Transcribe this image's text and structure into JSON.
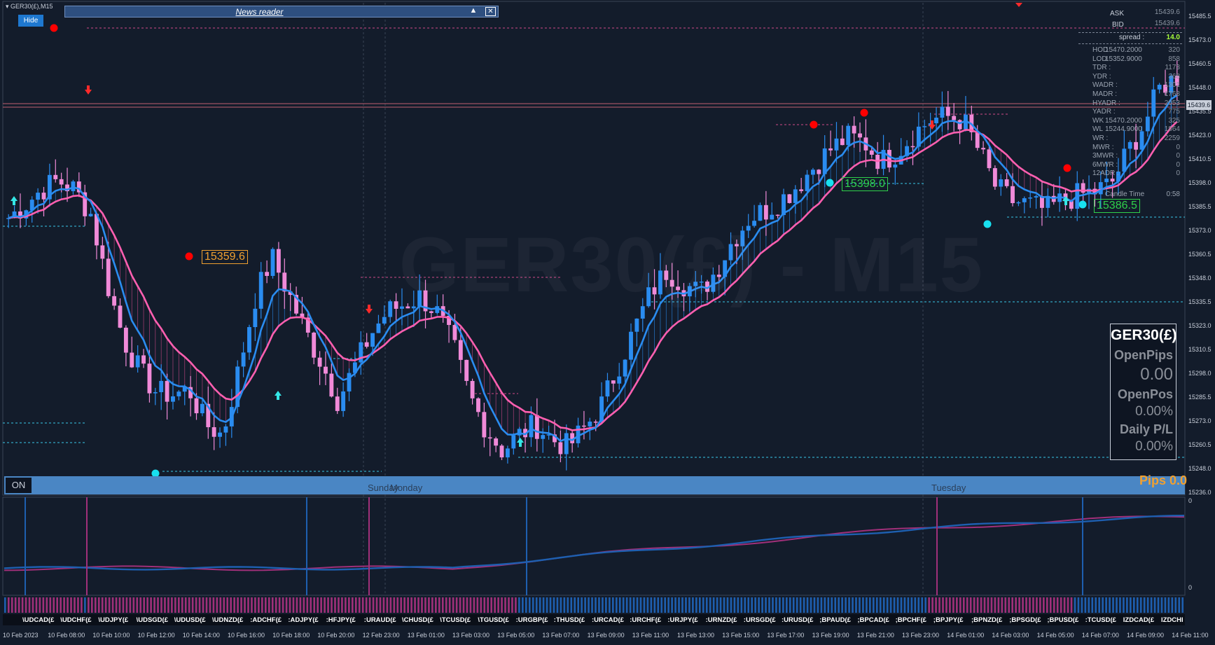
{
  "window": {
    "symbol_title": "GER30(£),M15",
    "watermark": "GER30(£) - M15"
  },
  "news_reader": {
    "title": "News reader",
    "collapse_icon": "triangle-up-icon",
    "close_icon": "close-icon"
  },
  "hide_button": {
    "label": "Hide"
  },
  "info_panel": {
    "ask_label": "ASK",
    "ask_value": "15439.6",
    "bid_label": "BID",
    "bid_value": "15439.6",
    "spread_label": "spread :",
    "spread_value": "14.0",
    "rows": [
      {
        "label": "HOD",
        "mid": "15470.2000",
        "value": "320"
      },
      {
        "label": "LOD",
        "mid": "15352.9000",
        "value": "858"
      },
      {
        "label": "TDR :",
        "value": "1173"
      },
      {
        "label": "YDR :",
        "value": "368"
      },
      {
        "label": "WADR :",
        "value": "1301"
      },
      {
        "label": "MADR :",
        "value": "1768"
      },
      {
        "label": "HYADR :",
        "value": "2053"
      },
      {
        "label": "YADR :",
        "value": "775"
      },
      {
        "label": "WK",
        "mid": "15470.2000",
        "value": "325"
      },
      {
        "label": "WL",
        "mid": "15244.9000",
        "value": "1864"
      },
      {
        "label": "WR :",
        "value": "2259"
      },
      {
        "label": "MWR :",
        "value": "0"
      },
      {
        "label": "3MWR :",
        "value": "0"
      },
      {
        "label": "6MWR :",
        "value": "0"
      },
      {
        "label": "12ADR :",
        "value": "0"
      }
    ],
    "candle_time_label": "Candle Time",
    "candle_time_value": "0:58"
  },
  "price_axis": [
    "15485.5",
    "15473.0",
    "15460.5",
    "15448.0",
    "15435.5",
    "15423.0",
    "15410.5",
    "15398.0",
    "15385.5",
    "15373.0",
    "15360.5",
    "15348.0",
    "15335.5",
    "15323.0",
    "15310.5",
    "15298.0",
    "15285.5",
    "15273.0",
    "15260.5",
    "15248.0",
    "15236.0"
  ],
  "current_price_label": "15439.6",
  "osc_axis": {
    "top": "0",
    "bottom": "0"
  },
  "price_tags": [
    {
      "text": "15359.6",
      "color": "#f0a030"
    },
    {
      "text": "15398.0",
      "color": "#2fd04a"
    },
    {
      "text": "15386.5",
      "color": "#2fd04a"
    }
  ],
  "day_labels": [
    "Sunday",
    "Monday",
    "Tuesday"
  ],
  "pnl_panel": {
    "symbol": "GER30(£)",
    "open_pips_label": "OpenPips",
    "open_pips_value": "0.00",
    "open_pos_label": "OpenPos",
    "open_pos_value": "0.00%",
    "daily_pl_label": "Daily P/L",
    "daily_pl_value": "0.00%"
  },
  "bottom_bar": {
    "on_label": "ON",
    "pips_label": "Pips 0.0"
  },
  "symbol_strip": [
    "\\UDCAD(£",
    "\\UDCHF(£",
    "\\UDJPY(£",
    "\\UDSGD(£",
    "\\UDUSD(£",
    "\\UDNZD(£",
    ":ADCHF(£",
    ":ADJPY(£",
    ":HFJPY(£",
    ":URAUD(£",
    "\\CHUSD(£",
    "\\TCUSD(£",
    "\\TGUSD(£",
    ":URGBP(£",
    ":THUSD(£",
    ":URCAD(£",
    ":URCHF(£",
    ":URJPY(£",
    ":URNZD(£",
    ":URSGD(£",
    ":URUSD(£",
    ";BPAUD(£",
    ";BPCAD(£",
    ";BPCHF(£",
    ";BPJPY(£",
    ";BPNZD(£",
    ";BPSGD(£",
    ";BPUSD(£",
    ":TCUSD(£",
    "IZDCAD(£",
    "IZDCHI"
  ],
  "time_axis": [
    "10 Feb 2023",
    "10 Feb 08:00",
    "10 Feb 10:00",
    "10 Feb 12:00",
    "10 Feb 14:00",
    "10 Feb 16:00",
    "10 Feb 18:00",
    "10 Feb 20:00",
    "12 Feb 23:00",
    "13 Feb 01:00",
    "13 Feb 03:00",
    "13 Feb 05:00",
    "13 Feb 07:00",
    "13 Feb 09:00",
    "13 Feb 11:00",
    "13 Feb 13:00",
    "13 Feb 15:00",
    "13 Feb 17:00",
    "13 Feb 19:00",
    "13 Feb 21:00",
    "13 Feb 23:00",
    "14 Feb 01:00",
    "14 Feb 03:00",
    "14 Feb 05:00",
    "14 Feb 07:00",
    "14 Feb 09:00",
    "14 Feb 11:00"
  ],
  "colors": {
    "bull": "#2a8cf0",
    "bear": "#f08ad8",
    "ma_pink": "#ff5fb0",
    "ma_blue": "#2a8cf0",
    "background": "#131c2b",
    "buy_arrow": "#34e6e6",
    "sell_arrow": "#ff2a2a",
    "fractal_high": "#ff0000",
    "fractal_low": "#18e0f0"
  },
  "chart_data": {
    "type": "candlestick",
    "ylim": [
      15236,
      15490
    ],
    "price_path": [
      15380,
      15387,
      15395,
      15400,
      15395,
      15382,
      15345,
      15315,
      15298,
      15287,
      15286,
      15288,
      15270,
      15264,
      15300,
      15338,
      15359,
      15340,
      15320,
      15303,
      15283,
      15300,
      15318,
      15330,
      15334,
      15338,
      15330,
      15312,
      15285,
      15268,
      15256,
      15264,
      15270,
      15262,
      15258,
      15268,
      15280,
      15300,
      15320,
      15340,
      15352,
      15345,
      15340,
      15352,
      15368,
      15380,
      15384,
      15390,
      15398,
      15408,
      15417,
      15423,
      15420,
      15410,
      15415,
      15425,
      15432,
      15434,
      15432,
      15415,
      15396,
      15389,
      15387,
      15384,
      15389,
      15392,
      15394,
      15398,
      15415,
      15430,
      15450,
      15455
    ]
  }
}
